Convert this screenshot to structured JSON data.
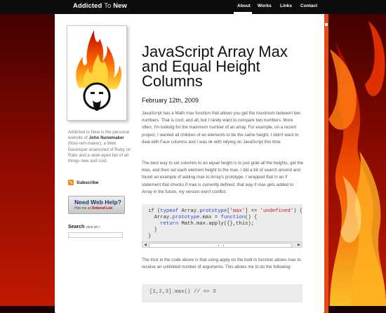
{
  "header": {
    "brand_main": "Addicted",
    "brand_to": "To",
    "brand_end": "New",
    "nav": [
      "About",
      "Works",
      "Links",
      "Contact"
    ]
  },
  "sidebar": {
    "bio_1": "Addicted to New is the personal website of",
    "bio_name": "John Nunemaker",
    "bio_2": "(Noo-neh-maker), a Web Developer enamored of Ruby on Rails and a wide-eyed fan of all things new and cool.",
    "subscribe": "Subscribe",
    "help_title": "Need Web Help?",
    "help_sub_pre": "Hire me at",
    "help_sub_link": "Ordered List",
    "search_label": "Search",
    "search_view_all": "view all »",
    "search_placeholder": ""
  },
  "article": {
    "title": "JavaScript Array Max and Equal Height Columns",
    "date": "February 12th, 2009",
    "para1": "JavaScript has a Math max function that allows you get the maximum between two numbers. That is cool, and all, but I rarely want to compare two numbers. More often, I'm looking for the maximum number of an array. For example, on a recent project, I wanted all children of an elements to be the same height. I didn't want to deal with Faux columns and I was ok with relying on JavaScript this time.",
    "para2": "The best way to set columns to an equal height is to just grab all the heights, get the max, and then set each element height to the max. I did a bit of search around and found an example of adding max to Array's prototype. I wrapped that in an if statement that checks if max is currently defined, that way if max gets added to Array in the future, my version won't conflict.",
    "code1": {
      "l1_a": "if (",
      "l1_b": "typeof",
      "l1_c": " Array.",
      "l1_d": "prototype",
      "l1_e": "[",
      "l1_f": "'max'",
      "l1_g": "] == ",
      "l1_h": "'undefined'",
      "l1_i": ") {",
      "l2_a": "  Array.",
      "l2_b": "prototype",
      "l2_c": ".max = ",
      "l2_d": "function",
      "l2_e": "() {",
      "l3_a": "    ",
      "l3_b": "return",
      "l3_c": " Math.max.apply({},this);",
      "l4": "  }",
      "l5": "}"
    },
    "para3": "The trick in the code above is that using apply on the built in function allows max to receive an unlimited number of arguments. This allows me to do the following:",
    "code2": "[1,2,3].max() // => 3"
  },
  "colors": {
    "accent": "#e74b15",
    "keyword": "#2b46d1",
    "string": "#c81818"
  }
}
